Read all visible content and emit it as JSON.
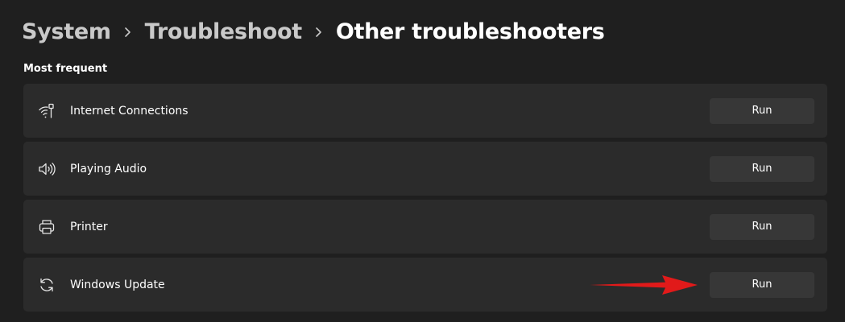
{
  "breadcrumb": {
    "items": [
      "System",
      "Troubleshoot",
      "Other troubleshooters"
    ]
  },
  "section": {
    "title": "Most frequent"
  },
  "rows": [
    {
      "label": "Internet Connections",
      "icon": "wifi-network-icon",
      "button": "Run"
    },
    {
      "label": "Playing Audio",
      "icon": "speaker-icon",
      "button": "Run"
    },
    {
      "label": "Printer",
      "icon": "printer-icon",
      "button": "Run"
    },
    {
      "label": "Windows Update",
      "icon": "sync-icon",
      "button": "Run"
    }
  ],
  "colors": {
    "background": "#1f1f1f",
    "row_background": "#2b2b2b",
    "button_background": "#373737",
    "breadcrumb_inactive": "#c9c9c9",
    "annotation_arrow": "#e11a1a"
  }
}
